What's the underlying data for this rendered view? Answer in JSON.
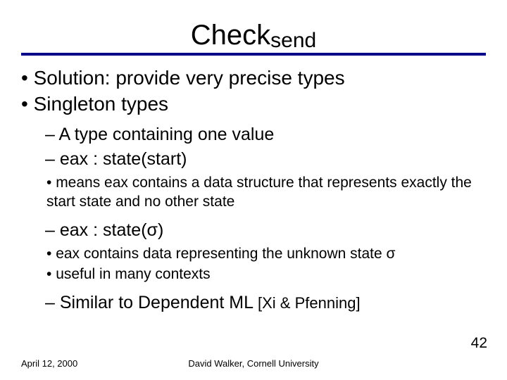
{
  "title": {
    "main": "Check",
    "sub": "send"
  },
  "bullets": {
    "l1": [
      "Solution: provide very precise types",
      "Singleton types"
    ],
    "l2": [
      "A type containing one value",
      "eax : state(start)",
      "eax : state(σ)",
      "Similar to Dependent ML "
    ],
    "ref": "[Xi & Pfenning]",
    "l3a": [
      "means eax contains a data structure that represents exactly the start state and no other state"
    ],
    "l3b": [
      "eax contains data representing the unknown state σ",
      "useful in many contexts"
    ]
  },
  "footer": {
    "date": "April 12, 2000",
    "center": "David Walker, Cornell University",
    "page": "42"
  }
}
